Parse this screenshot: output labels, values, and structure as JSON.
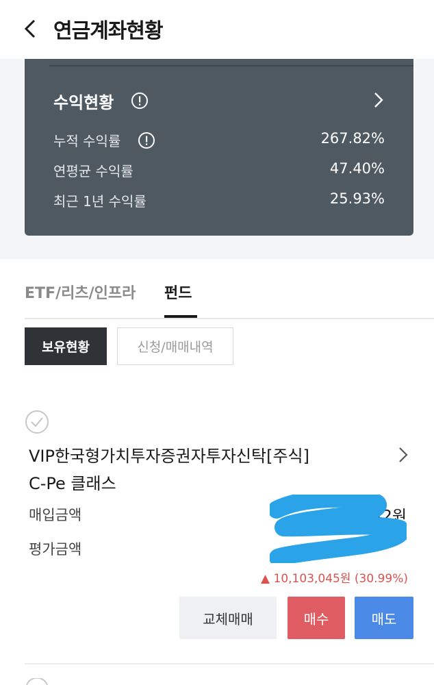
{
  "header": {
    "title": "연금계좌현황"
  },
  "summary_card": {
    "title": "수익현황",
    "stats": [
      {
        "label": "누적 수익률",
        "value": "267.82%",
        "has_info": true
      },
      {
        "label": "연평균 수익률",
        "value": "47.40%",
        "has_info": false
      },
      {
        "label": "최근 1년 수익률",
        "value": "25.93%",
        "has_info": false
      }
    ]
  },
  "tabs": [
    {
      "label": "ETF/리츠/인프라",
      "active": false
    },
    {
      "label": "펀드",
      "active": true
    }
  ],
  "subtabs": [
    {
      "label": "보유현황",
      "active": true
    },
    {
      "label": "신청/매매내역",
      "active": false
    }
  ],
  "fund": {
    "name_line1": "VIP한국형가치투자증권자투자신탁[주식]",
    "name_line2": "C-Pe 클래스",
    "purchase_label": "매입금액",
    "purchase_value_visible": "42원",
    "eval_label": "평가금액",
    "eval_value_visible": "",
    "profit_text": "▲ 10,103,045원 (30.99%)"
  },
  "actions": {
    "swap": "교체매매",
    "buy": "매수",
    "sell": "매도"
  },
  "colors": {
    "card_bg": "#4f5962",
    "buy": "#e05c63",
    "sell": "#4a8ae6",
    "profit": "#d9534f",
    "redaction": "#2aa3e8"
  },
  "icons": [
    "back-chevron-icon",
    "info-icon",
    "chevron-right-icon",
    "check-circle-icon"
  ]
}
